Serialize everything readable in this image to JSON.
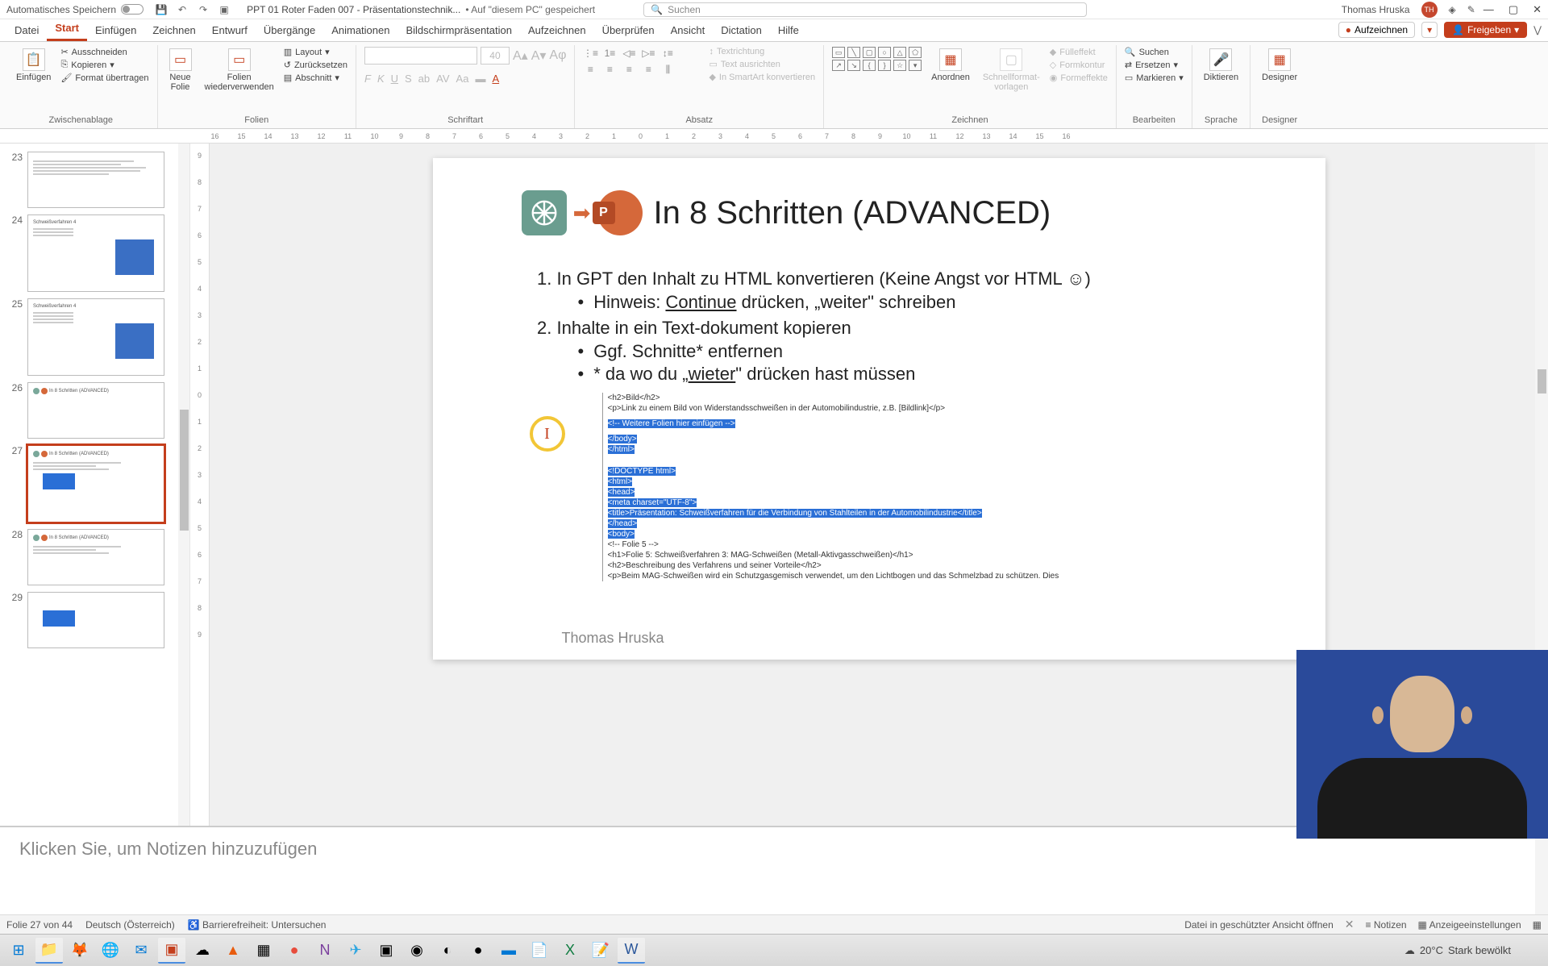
{
  "titlebar": {
    "autosave": "Automatisches Speichern",
    "doc": "PPT 01 Roter Faden 007 - Präsentationstechnik...",
    "saved": "• Auf \"diesem PC\" gespeichert",
    "search_placeholder": "Suchen",
    "user": "Thomas Hruska",
    "initials": "TH"
  },
  "tabs": {
    "datei": "Datei",
    "start": "Start",
    "einfuegen": "Einfügen",
    "zeichnen": "Zeichnen",
    "entwurf": "Entwurf",
    "uebergaenge": "Übergänge",
    "animationen": "Animationen",
    "bildschirm": "Bildschirmpräsentation",
    "aufzeichnen": "Aufzeichnen",
    "ueberpruefen": "Überprüfen",
    "ansicht": "Ansicht",
    "dictation": "Dictation",
    "hilfe": "Hilfe",
    "record_btn": "Aufzeichnen",
    "share_btn": "Freigeben"
  },
  "ribbon": {
    "zwischenablage": {
      "label": "Zwischenablage",
      "einfuegen": "Einfügen",
      "ausschneiden": "Ausschneiden",
      "kopieren": "Kopieren",
      "format": "Format übertragen"
    },
    "folien": {
      "label": "Folien",
      "neue": "Neue\nFolie",
      "wieder": "Folien\nwiederverwenden",
      "layout": "Layout",
      "zuruecksetzen": "Zurücksetzen",
      "abschnitt": "Abschnitt"
    },
    "schriftart": {
      "label": "Schriftart",
      "size": "40"
    },
    "absatz": {
      "label": "Absatz",
      "textrichtung": "Textrichtung",
      "ausrichten": "Text ausrichten",
      "smartart": "In SmartArt konvertieren"
    },
    "zeichnen": {
      "label": "Zeichnen",
      "anordnen": "Anordnen",
      "schnellformat": "Schnellformat-\nvorlagen",
      "fuelleffekt": "Fülleffekt",
      "formkontur": "Formkontur",
      "formeffekte": "Formeffekte"
    },
    "bearbeiten": {
      "label": "Bearbeiten",
      "suchen": "Suchen",
      "ersetzen": "Ersetzen",
      "markieren": "Markieren"
    },
    "sprache": {
      "label": "Sprache",
      "diktieren": "Diktieren"
    },
    "designer": {
      "label": "Designer",
      "designer": "Designer"
    }
  },
  "thumbs": {
    "n23": "23",
    "n24": "24",
    "n25": "25",
    "n26": "26",
    "n27": "27",
    "n28": "28",
    "n29": "29",
    "title_26_28": "In 8 Schritten (ADVANCED)"
  },
  "slide": {
    "title": "In 8 Schritten  (ADVANCED)",
    "li1_pre": "In GPT den Inhalt zu HTML konvertieren (Keine Angst vor HTML ",
    "li1_post": ")",
    "li1_sub_pre": "Hinweis: ",
    "li1_sub_underlined": "Continue",
    "li1_sub_post": " drücken, „weiter\" schreiben",
    "li2": "Inhalte in ein Text-dokument kopieren",
    "li2_sub1": "Ggf. Schnitte* entfernen",
    "li2_sub2_pre": "* da wo du „",
    "li2_sub2_u": "wieter",
    "li2_sub2_post": "\" drücken hast müssen",
    "author": "Thomas Hruska",
    "code": {
      "l1": "<h2>Bild</h2>",
      "l2": "<p>Link zu einem Bild von Widerstandsschweißen in der Automobilindustrie, z.B. [Bildlink]</p>",
      "l3": "<!-- Weitere Folien hier einfügen -->",
      "l4": "</body>",
      "l5": "</html>",
      "l6": "<!DOCTYPE html>",
      "l7": "<html>",
      "l8": "<head>",
      "l9": "    <meta charset=\"UTF-8\">",
      "l10": "    <title>Präsentation: Schweißverfahren für die Verbindung von Stahlteilen in der Automobilindustrie</title>",
      "l11": "</head>",
      "l12": "<body>",
      "l13": "<!-- Folie 5 -->",
      "l14": "<h1>Folie 5: Schweißverfahren 3: MAG-Schweißen (Metall-Aktivgasschweißen)</h1>",
      "l15": "<h2>Beschreibung des Verfahrens und seiner Vorteile</h2>",
      "l16": "<p>Beim MAG-Schweißen wird ein Schutzgasgemisch verwendet, um den Lichtbogen und das Schmelzbad zu schützen. Dies"
    }
  },
  "notes": {
    "placeholder": "Klicken Sie, um Notizen hinzuzufügen"
  },
  "status": {
    "folie": "Folie 27 von 44",
    "sprache": "Deutsch (Österreich)",
    "barriere": "Barrierefreiheit: Untersuchen",
    "geschuetzt": "Datei in geschützter Ansicht öffnen",
    "notizen": "Notizen",
    "anzeige": "Anzeigeeinstellungen"
  },
  "taskbar": {
    "temp": "20°C",
    "weather": "Stark bewölkt"
  }
}
